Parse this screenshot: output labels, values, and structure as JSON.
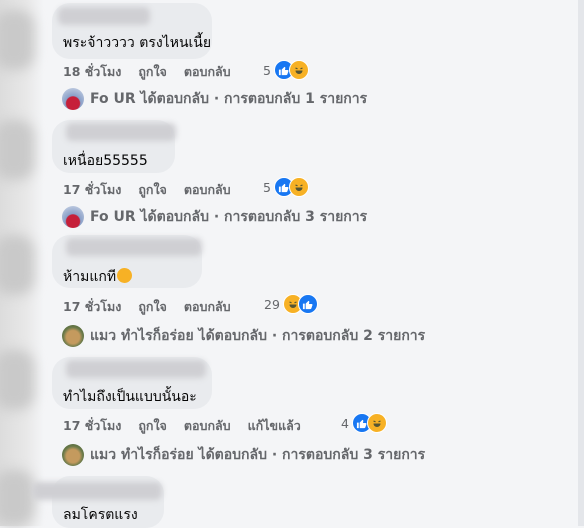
{
  "comments": [
    {
      "text": "พระจ้าวววว ตรงไหนเนี้ย",
      "time": "18 ชั่วโมง",
      "like_label": "ถูกใจ",
      "reply_label": "ตอบกลับ",
      "edited_label": "",
      "reaction_count": "5",
      "reactions": [
        "like-icon",
        "haha-icon"
      ],
      "reply_summary": {
        "author": "Fo UR",
        "text": "ได้ตอบกลับ · การตอบกลับ 1 รายการ",
        "avatar": "red-figure-avatar"
      }
    },
    {
      "text": "เหนื่อย55555",
      "time": "17 ชั่วโมง",
      "like_label": "ถูกใจ",
      "reply_label": "ตอบกลับ",
      "edited_label": "",
      "reaction_count": "5",
      "reactions": [
        "like-icon",
        "haha-icon"
      ],
      "reply_summary": {
        "author": "Fo UR",
        "text": "ได้ตอบกลับ · การตอบกลับ 3 รายการ",
        "avatar": "red-figure-avatar"
      }
    },
    {
      "text": "ห้ามแกที",
      "text_emoji": "laughing-emoji",
      "time": "17 ชั่วโมง",
      "like_label": "ถูกใจ",
      "reply_label": "ตอบกลับ",
      "edited_label": "",
      "reaction_count": "29",
      "reactions": [
        "haha-icon",
        "like-icon"
      ],
      "reply_summary": {
        "author": "แมว ทำไรก็อร่อย",
        "text": "ได้ตอบกลับ · การตอบกลับ 2 รายการ",
        "avatar": "cat-avatar"
      }
    },
    {
      "text": "ทำไมถึงเป็นแบบนั้นอะ",
      "time": "17 ชั่วโมง",
      "like_label": "ถูกใจ",
      "reply_label": "ตอบกลับ",
      "edited_label": "แก้ไขแล้ว",
      "reaction_count": "4",
      "reactions": [
        "like-icon",
        "haha-icon"
      ],
      "reply_summary": {
        "author": "แมว ทำไรก็อร่อย",
        "text": "ได้ตอบกลับ · การตอบกลับ 3 รายการ",
        "avatar": "cat-avatar"
      }
    },
    {
      "text": "ลมโครตแรง"
    }
  ],
  "colors": {
    "like": "#1877f2",
    "haha": "#f7b125",
    "meta": "#65676b",
    "bubble": "#e9ebee"
  }
}
